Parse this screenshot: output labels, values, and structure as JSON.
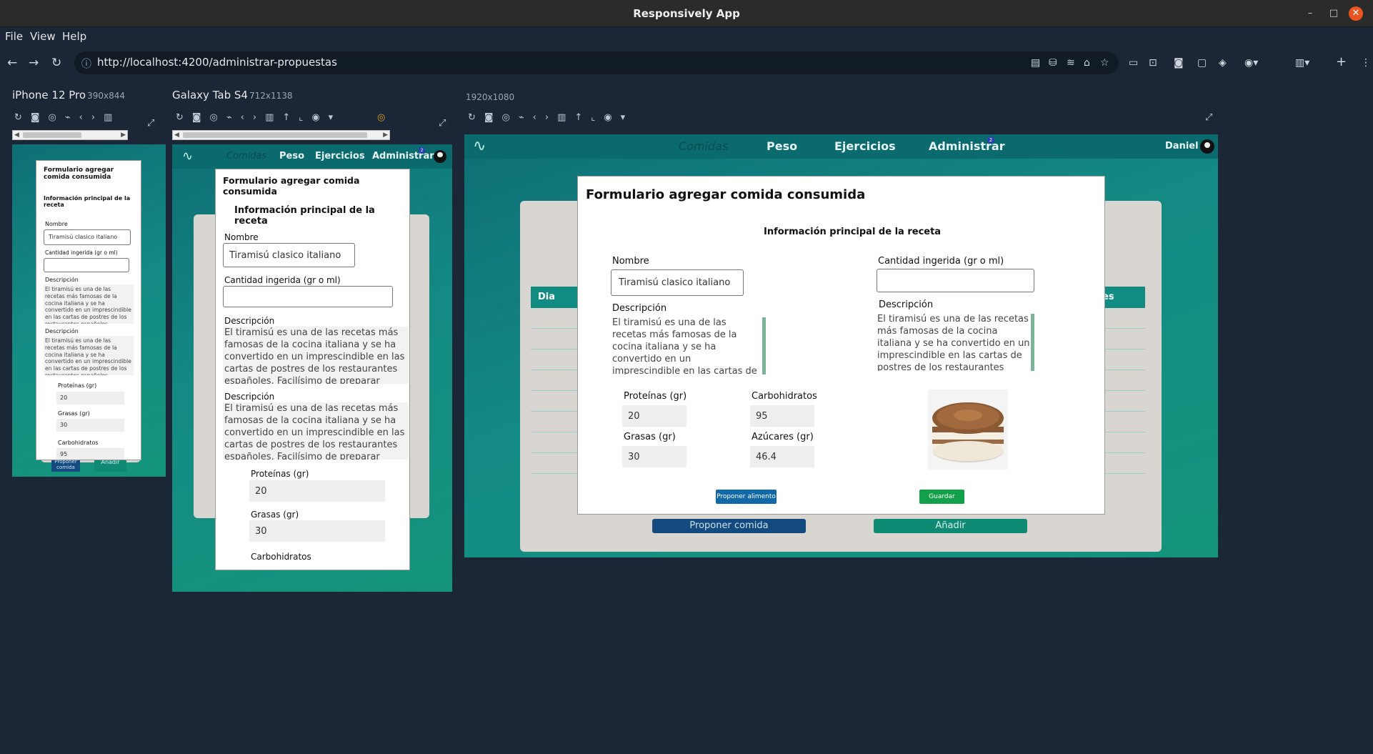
{
  "window": {
    "title": "Responsively App"
  },
  "menu": {
    "file": "File",
    "view": "View",
    "help": "Help"
  },
  "browser": {
    "url": "http://localhost:4200/administrar-propuestas"
  },
  "icons": {
    "back": "arrow-left-icon",
    "forward": "arrow-right-icon",
    "reload": "reload-icon",
    "info": "info-icon"
  },
  "devices": [
    {
      "name": "iPhone 12 Pro",
      "size": "390x844"
    },
    {
      "name": "Galaxy Tab S4",
      "size": "712x1138"
    },
    {
      "name": "",
      "size": "1920x1080"
    }
  ],
  "app": {
    "nav": {
      "comidas": "Comidas",
      "peso": "Peso",
      "ejercicios": "Ejercicios",
      "administrar": "Administrar",
      "badge": "2",
      "user": "Daniel"
    },
    "table": {
      "col_dia": "Dia",
      "col_last": "es"
    },
    "bottom": {
      "proponer": "Proponer comida",
      "anadir": "Añadir"
    }
  },
  "form": {
    "title": "Formulario agregar comida consumida",
    "subtitle": "Información principal de la receta",
    "nombre_label": "Nombre",
    "nombre_value": "Tiramisú clasico italiano",
    "cantidad_label": "Cantidad ingerida (gr o ml)",
    "cantidad_value": "",
    "descripcion_label": "Descripción",
    "descripcion_full": "El tiramisú es una de las recetas más famosas de la cocina italiana y se ha convertido en un imprescindible en las cartas de postres de los restaurantes españoles. Facilísimo de preparar",
    "proteinas_label": "Proteínas (gr)",
    "proteinas_value": "20",
    "carbohidratos_label": "Carbohidratos",
    "carbohidratos_value": "95",
    "grasas_label": "Grasas (gr)",
    "grasas_value": "30",
    "azucares_label": "Azúcares (gr)",
    "azucares_value": "46.4",
    "proponer_alimento": "Proponer alimento",
    "guardar": "Guardar",
    "phone_proponer": "Proponer comida",
    "phone_anadir": "Añadir"
  },
  "colors": {
    "teal": "#0b6a6e",
    "accent_green": "#12a04a",
    "accent_blue": "#1368a8"
  }
}
